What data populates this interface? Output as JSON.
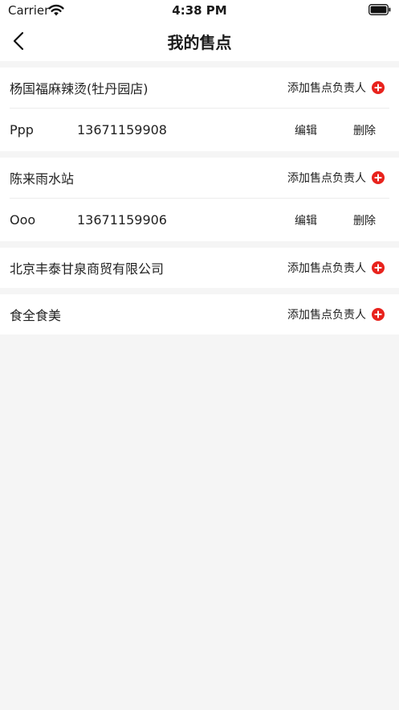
{
  "status_bar": {
    "carrier": "Carrier",
    "time": "4:38 PM"
  },
  "nav": {
    "title": "我的售点"
  },
  "accent_color": "#e8231d",
  "stores": [
    {
      "name": "杨国福麻辣烫(牡丹园店)",
      "add_label": "添加售点负责人",
      "managers": [
        {
          "name": "Ppp",
          "phone": "13671159908",
          "edit_label": "编辑",
          "delete_label": "删除"
        }
      ]
    },
    {
      "name": "陈来雨水站",
      "add_label": "添加售点负责人",
      "managers": [
        {
          "name": "Ooo",
          "phone": "13671159906",
          "edit_label": "编辑",
          "delete_label": "删除"
        }
      ]
    },
    {
      "name": "北京丰泰甘泉商贸有限公司",
      "add_label": "添加售点负责人",
      "managers": []
    },
    {
      "name": "食全食美",
      "add_label": "添加售点负责人",
      "managers": []
    }
  ]
}
